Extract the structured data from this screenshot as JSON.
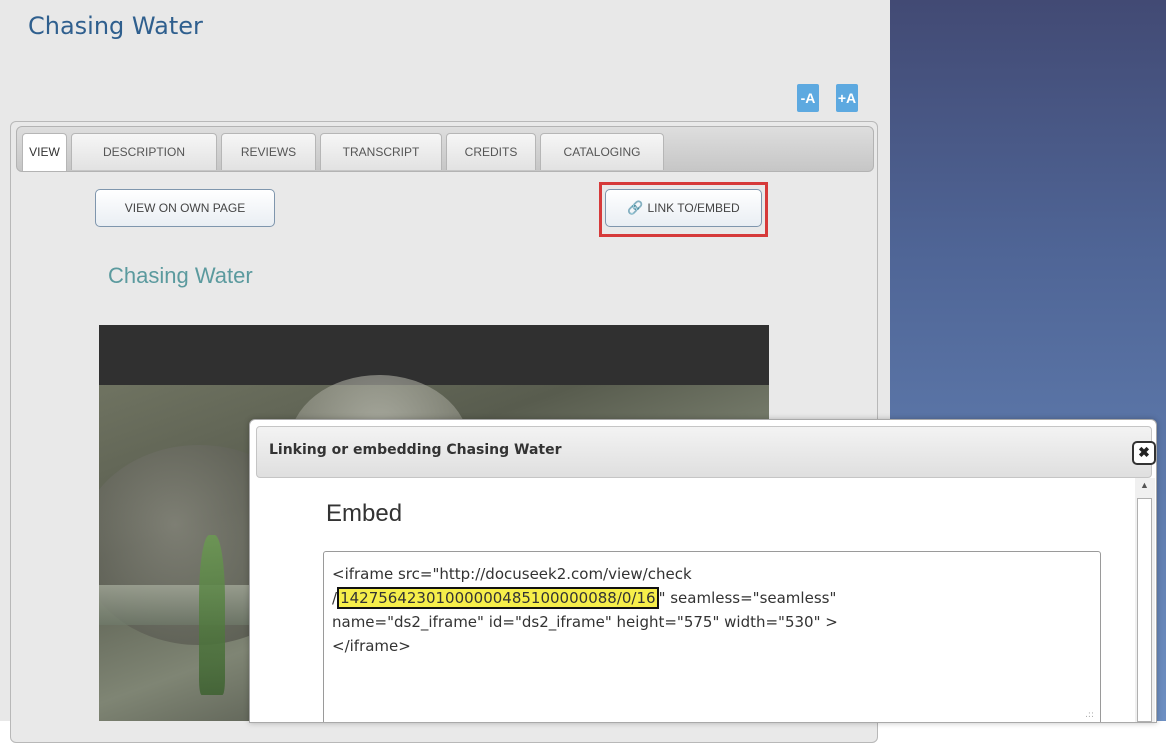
{
  "page": {
    "title": "Chasing Water"
  },
  "font_controls": {
    "decrease": "-A",
    "increase": "+A"
  },
  "tabs": [
    "VIEW",
    "DESCRIPTION",
    "REVIEWS",
    "TRANSCRIPT",
    "CREDITS",
    "CATALOGING"
  ],
  "actions": {
    "view_own_page": "VIEW ON OWN PAGE",
    "link_embed": "LINK TO/EMBED"
  },
  "video": {
    "title": "Chasing Water"
  },
  "dialog": {
    "title": "Linking or embedding Chasing Water",
    "close": "✖",
    "heading": "Embed",
    "code": {
      "line1": "<iframe src=\"http://docuseek2.com/view/check",
      "line2_prefix": "/",
      "line2_highlight": "14275642301000000485100000088/0/16",
      "line2_suffix": "\" seamless=\"seamless\"",
      "line3": "name=\"ds2_iframe\" id=\"ds2_iframe\" height=\"575\" width=\"530\" >",
      "line4": "</iframe>"
    }
  },
  "colors": {
    "title_blue": "#2f5f8e",
    "accent_button": "#5da9e0",
    "highlight_box": "#d63a3a",
    "code_highlight": "#f6ee4a",
    "video_title": "#5b9a9e"
  }
}
